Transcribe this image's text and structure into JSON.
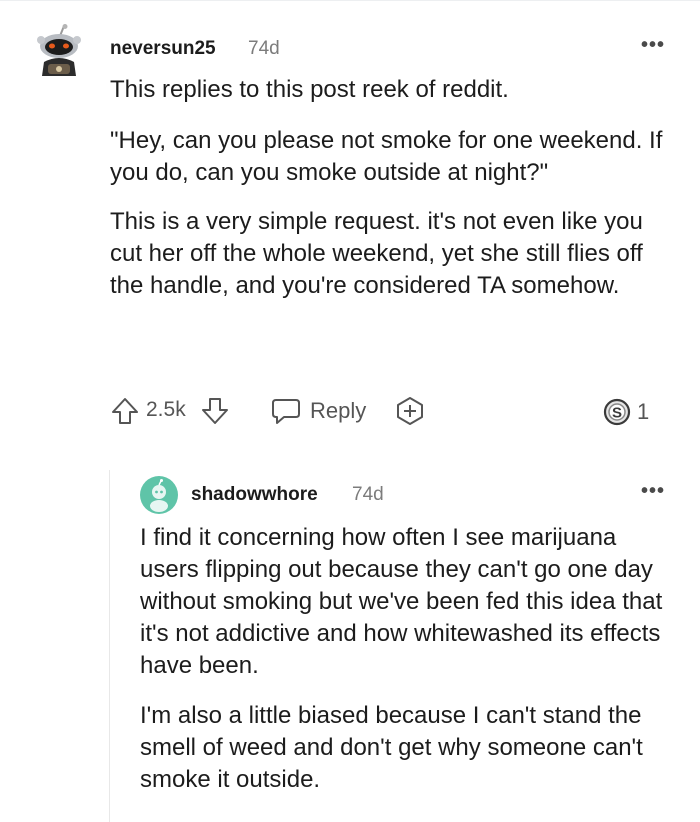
{
  "comment": {
    "author": "neversun25",
    "age": "74d",
    "more_label": "•••",
    "avatar_icon": "snoo-avatar-icon",
    "paragraphs": [
      "This replies to this post reek of reddit.",
      "\"Hey, can you please not smoke for one weekend. If you do, can you smoke outside at night?\"",
      "This is a very simple request. it's not even like you cut her off the whole weekend, yet she still flies off the handle, and you're considered TA somehow."
    ],
    "vote_count": "2.5k",
    "reply_label": "Reply",
    "award_count": "1"
  },
  "reply": {
    "author": "shadowwhore",
    "age": "74d",
    "more_label": "•••",
    "avatar_icon": "snoo-avatar-icon",
    "avatar_color": "#5fc4a8",
    "paragraphs": [
      "I find it concerning how often I see marijuana users flipping out because they can't go one day without smoking but we've been fed this idea that it's not addictive and how whitewashed its effects have been.",
      "I'm also a little biased because I can't stand the smell of weed and don't get why someone can't smoke it outside."
    ]
  }
}
